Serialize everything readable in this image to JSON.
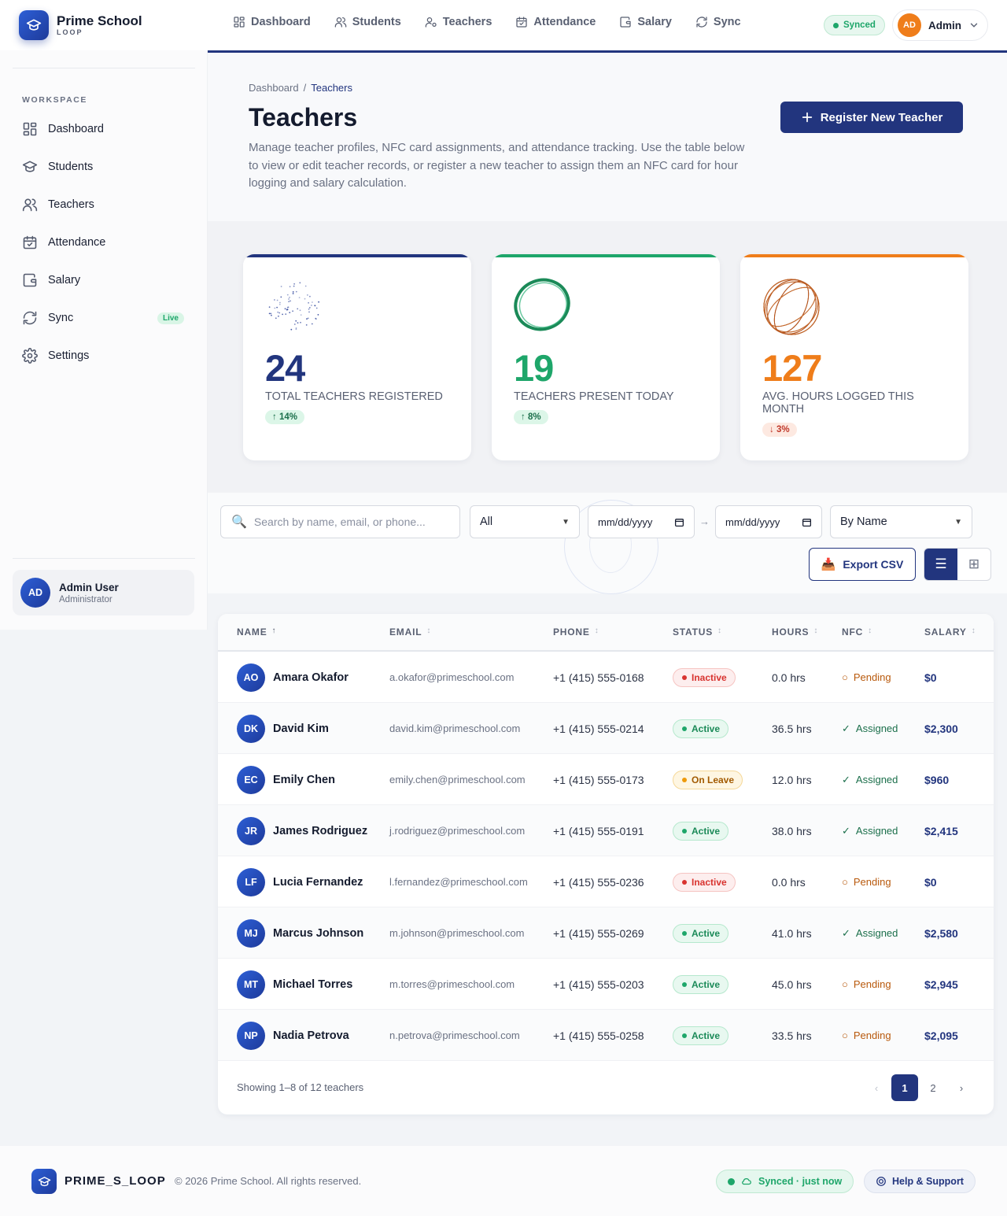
{
  "app": {
    "name": "Prime School",
    "sub": "LOOP",
    "footer_brand": "PRIME_S_LOOP",
    "copyright": "© 2026 Prime School. All rights reserved."
  },
  "topnav": [
    {
      "label": "Dashboard",
      "icon": "dashboard-icon"
    },
    {
      "label": "Students",
      "icon": "students-icon"
    },
    {
      "label": "Teachers",
      "icon": "teachers-icon"
    },
    {
      "label": "Attendance",
      "icon": "attendance-icon"
    },
    {
      "label": "Salary",
      "icon": "salary-icon"
    },
    {
      "label": "Sync",
      "icon": "sync-icon"
    }
  ],
  "header": {
    "synced_label": "Synced",
    "admin_initials": "AD",
    "admin_name": "Admin"
  },
  "sidebar": {
    "section_label": "WORKSPACE",
    "items": [
      {
        "label": "Dashboard",
        "icon": "dashboard-icon"
      },
      {
        "label": "Students",
        "icon": "graduation-cap-icon"
      },
      {
        "label": "Teachers",
        "icon": "users-icon"
      },
      {
        "label": "Attendance",
        "icon": "calendar-check-icon"
      },
      {
        "label": "Salary",
        "icon": "wallet-icon"
      },
      {
        "label": "Sync",
        "icon": "sync-icon",
        "badge": "Live"
      },
      {
        "label": "Settings",
        "icon": "gear-icon"
      }
    ],
    "user": {
      "initials": "AD",
      "name": "Admin User",
      "role": "Administrator"
    }
  },
  "page": {
    "breadcrumb": [
      "Dashboard",
      "Teachers"
    ],
    "title": "Teachers",
    "description": "Manage teacher profiles, NFC card assignments, and attendance tracking. Use the table below to view or edit teacher records, or register a new teacher to assign them an NFC card for hour logging and salary calculation.",
    "register_label": "Register New Teacher"
  },
  "stats": [
    {
      "value": "24",
      "label": "TOTAL TEACHERS REGISTERED",
      "delta": "↑ 14%",
      "trend": "up",
      "color": "#22357e"
    },
    {
      "value": "19",
      "label": "TEACHERS PRESENT TODAY",
      "delta": "↑ 8%",
      "trend": "up",
      "color": "#1ea66a"
    },
    {
      "value": "127",
      "label": "AVG. HOURS LOGGED THIS MONTH",
      "delta": "↓ 3%",
      "trend": "down",
      "color": "#ef7d1a"
    }
  ],
  "filters": {
    "search_placeholder": "Search by name, email, or phone...",
    "status_value": "All",
    "date_from": "mm/dd/yyyy",
    "date_to": "mm/dd/yyyy",
    "date_sep": "→",
    "sort_value": "By Name",
    "export_label": "Export CSV"
  },
  "table": {
    "columns": [
      "Name",
      "Email",
      "Phone",
      "Status",
      "Hours",
      "NFC",
      "Salary"
    ],
    "rows": [
      {
        "initials": "AO",
        "name": "Amara Okafor",
        "email": "a.okafor@primeschool.com",
        "phone": "+1 (415) 555-0168",
        "status": "Inactive",
        "hours": "0.0 hrs",
        "nfc": "Pending",
        "salary": "$0"
      },
      {
        "initials": "DK",
        "name": "David Kim",
        "email": "david.kim@primeschool.com",
        "phone": "+1 (415) 555-0214",
        "status": "Active",
        "hours": "36.5 hrs",
        "nfc": "Assigned",
        "salary": "$2,300"
      },
      {
        "initials": "EC",
        "name": "Emily Chen",
        "email": "emily.chen@primeschool.com",
        "phone": "+1 (415) 555-0173",
        "status": "On Leave",
        "hours": "12.0 hrs",
        "nfc": "Assigned",
        "salary": "$960"
      },
      {
        "initials": "JR",
        "name": "James Rodriguez",
        "email": "j.rodriguez@primeschool.com",
        "phone": "+1 (415) 555-0191",
        "status": "Active",
        "hours": "38.0 hrs",
        "nfc": "Assigned",
        "salary": "$2,415"
      },
      {
        "initials": "LF",
        "name": "Lucia Fernandez",
        "email": "l.fernandez@primeschool.com",
        "phone": "+1 (415) 555-0236",
        "status": "Inactive",
        "hours": "0.0 hrs",
        "nfc": "Pending",
        "salary": "$0"
      },
      {
        "initials": "MJ",
        "name": "Marcus Johnson",
        "email": "m.johnson@primeschool.com",
        "phone": "+1 (415) 555-0269",
        "status": "Active",
        "hours": "41.0 hrs",
        "nfc": "Assigned",
        "salary": "$2,580"
      },
      {
        "initials": "MT",
        "name": "Michael Torres",
        "email": "m.torres@primeschool.com",
        "phone": "+1 (415) 555-0203",
        "status": "Active",
        "hours": "45.0 hrs",
        "nfc": "Pending",
        "salary": "$2,945"
      },
      {
        "initials": "NP",
        "name": "Nadia Petrova",
        "email": "n.petrova@primeschool.com",
        "phone": "+1 (415) 555-0258",
        "status": "Active",
        "hours": "33.5 hrs",
        "nfc": "Pending",
        "salary": "$2,095"
      }
    ],
    "showing": "Showing 1–8 of 12 teachers",
    "pages": [
      "1",
      "2"
    ],
    "prev": "‹",
    "next": "›"
  },
  "footer": {
    "synced": "Synced · just now",
    "help": "Help & Support"
  }
}
